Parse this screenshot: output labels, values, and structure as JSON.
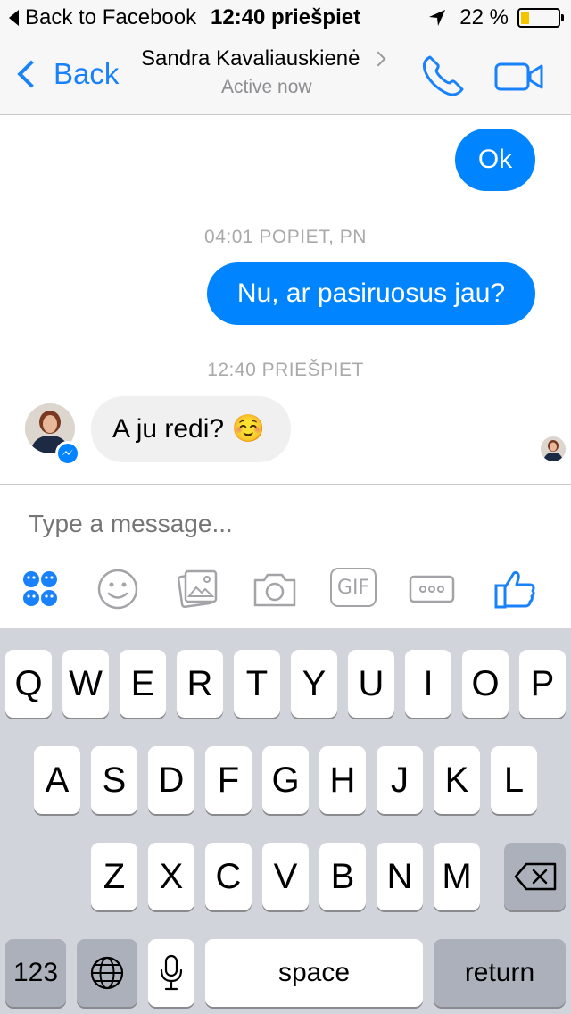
{
  "status_bar": {
    "back_label": "Back to Facebook",
    "time": "12:40 priešpiet",
    "battery": "22 %",
    "battery_fill_fraction": 0.22
  },
  "nav": {
    "back_label": "Back",
    "contact_name": "Sandra Kavaliauskienė",
    "status": "Active now",
    "accent_color": "#1982fb"
  },
  "messages": [
    {
      "direction": "outgoing",
      "text": "Ok"
    },
    {
      "timestamp": "04:01 POPIET, PN"
    },
    {
      "direction": "outgoing",
      "text": "Nu, ar pasiruosus jau?"
    },
    {
      "timestamp": "12:40 PRIEŠPIET"
    },
    {
      "direction": "incoming",
      "text": "A ju redi?",
      "emoji": "☺️"
    }
  ],
  "composer": {
    "placeholder": "Type a message...",
    "toolbar": [
      "stickers-icon",
      "emoji-icon",
      "gallery-icon",
      "camera-icon",
      "GIF",
      "more-icon",
      "like-icon"
    ],
    "bubble_color": "#0084ff"
  },
  "keyboard": {
    "row1": [
      "Q",
      "W",
      "E",
      "R",
      "T",
      "Y",
      "U",
      "I",
      "O",
      "P"
    ],
    "row2": [
      "A",
      "S",
      "D",
      "F",
      "G",
      "H",
      "J",
      "K",
      "L"
    ],
    "row3": [
      "Z",
      "X",
      "C",
      "V",
      "B",
      "N",
      "M"
    ],
    "numbers_label": "123",
    "space_label": "space",
    "return_label": "return"
  }
}
